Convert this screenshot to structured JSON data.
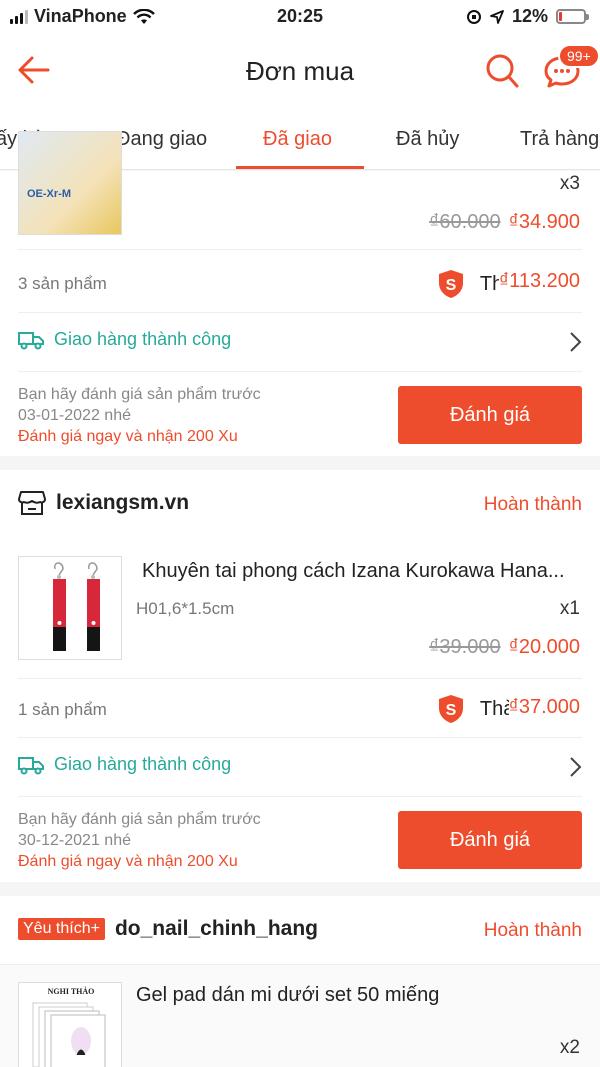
{
  "status_bar": {
    "carrier": "VinaPhone",
    "time": "20:25",
    "battery": "12%",
    "battery_level": 0.12
  },
  "header": {
    "title": "Đơn mua",
    "chat_badge": "99+"
  },
  "tabs": [
    {
      "label": "ấy hàng"
    },
    {
      "label": "Đang giao"
    },
    {
      "label": "Đã giao"
    },
    {
      "label": "Đã hủy"
    },
    {
      "label": "Trả hàng"
    }
  ],
  "order1": {
    "qty": "x3",
    "price_old": "₫60.000",
    "price_new": "₫34.900",
    "count": "3 sản phẩm",
    "total_label": "Thành tiền:",
    "total_amount": "₫113.200",
    "shipping": "Giao hàng thành công",
    "review_line1": "Bạn hãy đánh giá sản phẩm trước",
    "review_line2": "03-01-2022 nhé",
    "review_xu": "Đánh giá ngay và nhận 200 Xu",
    "review_button": "Đánh giá",
    "img_text": "OE-Xr-M"
  },
  "order2": {
    "shop": "lexiangsm.vn",
    "status": "Hoàn thành",
    "product": "Khuyên tai phong cách Izana Kurokawa Hana...",
    "variant": "H01,6*1.5cm",
    "qty": "x1",
    "price_old": "₫39.000",
    "price_new": "₫20.000",
    "count": "1 sản phẩm",
    "total_label": "Thành tiền:",
    "total_amount": "₫37.000",
    "shipping": "Giao hàng thành công",
    "review_line1": "Bạn hãy đánh giá sản phẩm trước",
    "review_line2": "30-12-2021 nhé",
    "review_xu": "Đánh giá ngay và nhận 200 Xu",
    "review_button": "Đánh giá"
  },
  "order3": {
    "badge": "Yêu thích+",
    "shop": "do_nail_chinh_hang",
    "status": "Hoàn thành",
    "product": "Gel pad dán mi dưới set 50 miếng",
    "qty": "x2",
    "img_title": "NGHI THẢO"
  },
  "colors": {
    "accent": "#ee4d2d",
    "shipping_green": "#26aa99"
  }
}
